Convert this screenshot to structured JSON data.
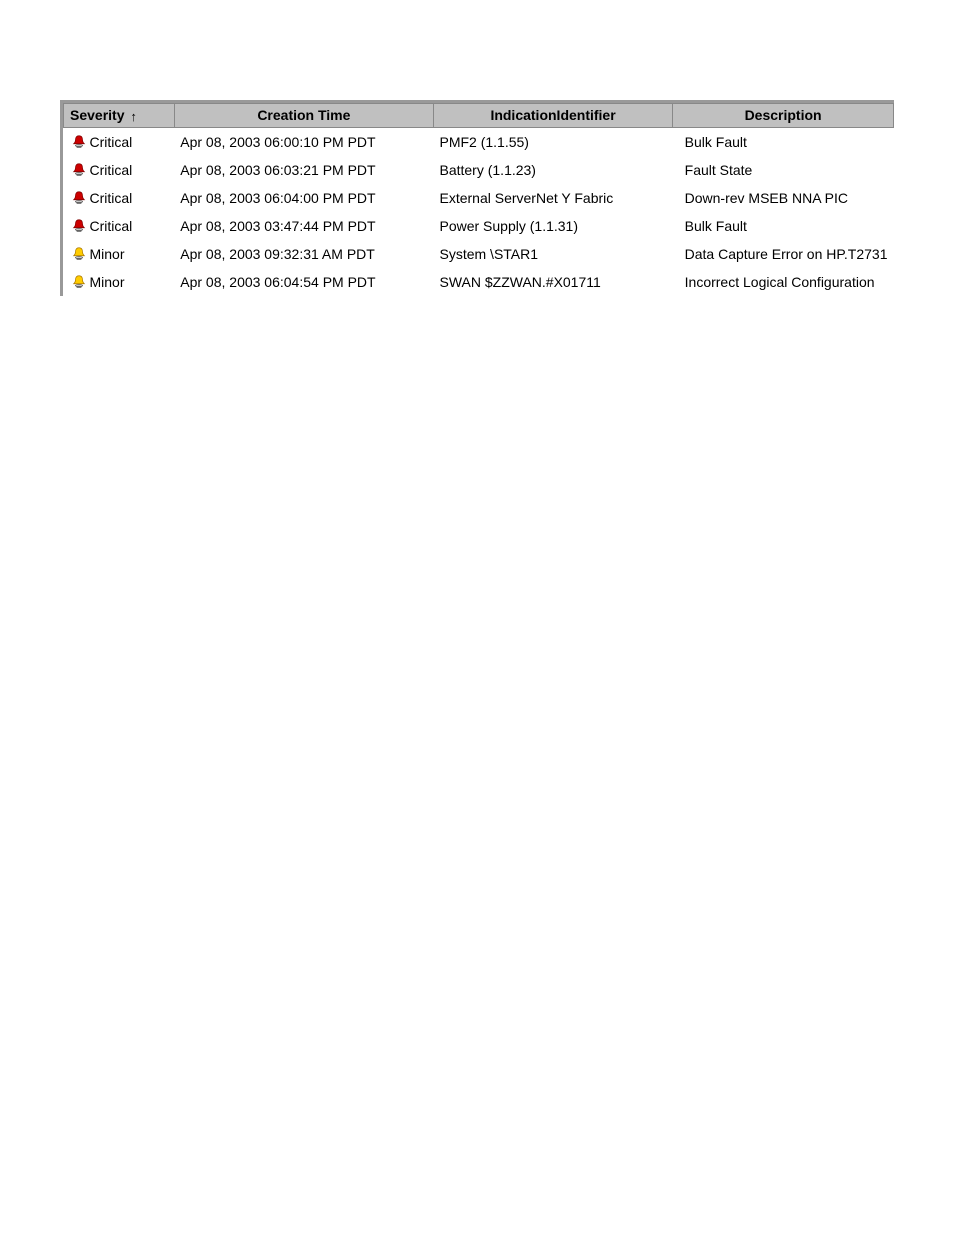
{
  "table": {
    "headers": {
      "severity": "Severity",
      "creation_time": "Creation Time",
      "indication_identifier": "IndicationIdentifier",
      "description": "Description"
    },
    "sort_indicator": "↑",
    "rows": [
      {
        "severity": "Critical",
        "severity_level": "critical",
        "creation_time": "Apr 08, 2003 06:00:10 PM PDT",
        "indication_identifier": "PMF2 (1.1.55)",
        "description": "Bulk Fault"
      },
      {
        "severity": "Critical",
        "severity_level": "critical",
        "creation_time": "Apr 08, 2003 06:03:21 PM PDT",
        "indication_identifier": "Battery (1.1.23)",
        "description": "Fault State"
      },
      {
        "severity": "Critical",
        "severity_level": "critical",
        "creation_time": "Apr 08, 2003 06:04:00 PM PDT",
        "indication_identifier": "External ServerNet Y Fabric",
        "description": "Down-rev MSEB NNA PIC"
      },
      {
        "severity": "Critical",
        "severity_level": "critical",
        "creation_time": "Apr 08, 2003 03:47:44 PM PDT",
        "indication_identifier": "Power Supply (1.1.31)",
        "description": "Bulk Fault"
      },
      {
        "severity": "Minor",
        "severity_level": "minor",
        "creation_time": "Apr 08, 2003 09:32:31 AM PDT",
        "indication_identifier": "System \\STAR1",
        "description": "Data Capture Error on HP.T2731"
      },
      {
        "severity": "Minor",
        "severity_level": "minor",
        "creation_time": "Apr 08, 2003 06:04:54 PM PDT",
        "indication_identifier": "SWAN $ZZWAN.#X01711",
        "description": "Incorrect Logical Configuration"
      }
    ]
  }
}
